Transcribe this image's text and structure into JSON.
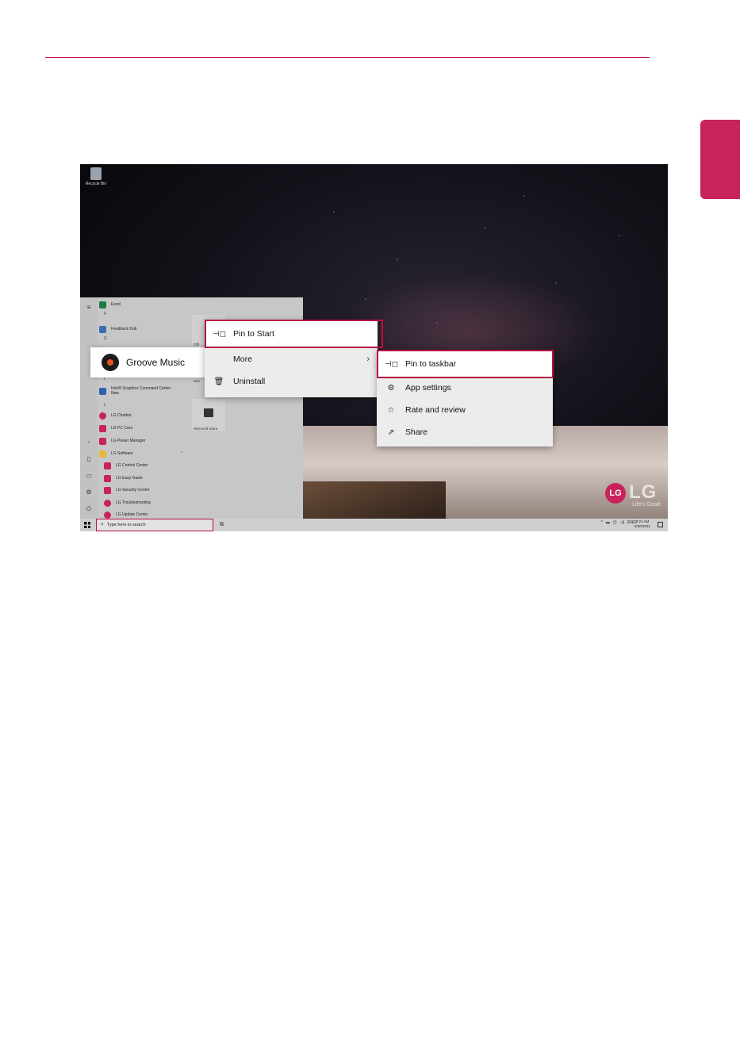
{
  "desktop": {
    "recycle_bin_label": "Recycle Bin",
    "brand": {
      "mark": "LG",
      "name": "LG",
      "tagline": "Life's Good",
      "color": "#c8235b"
    }
  },
  "start_menu": {
    "apps": [
      {
        "label": "Excel",
        "color": "#1d7a45"
      },
      {
        "label": "Feedback Hub",
        "color": "#3a6fb0"
      },
      {
        "label": "Intel® Graphics Command Center",
        "sub": "New",
        "color": "#2a62b0"
      },
      {
        "label": "LG Chatbot",
        "color": "#c8235b"
      },
      {
        "label": "LG PC Care",
        "color": "#c8235b"
      },
      {
        "label": "LG Power Manager",
        "color": "#c8235b"
      },
      {
        "label": "LG Software",
        "color": "#e6b840"
      },
      {
        "label": "LG Control Center",
        "color": "#c8235b"
      },
      {
        "label": "LG Easy Guide",
        "color": "#c8235b"
      },
      {
        "label": "LG Security Center",
        "color": "#c8235b"
      },
      {
        "label": "LG Troubleshooting",
        "color": "#c8235b"
      },
      {
        "label": "LG Update Center",
        "color": "#c8235b"
      }
    ],
    "letters": [
      "F",
      "G",
      "I",
      "L"
    ],
    "tiles": [
      {
        "label": "Offi"
      },
      {
        "label": "Micr"
      },
      {
        "label": "Microsoft Store"
      }
    ],
    "highlighted_app": {
      "label": "Groove Music"
    }
  },
  "context_menu": {
    "items": [
      {
        "label": "Pin to Start",
        "icon": "pin-icon"
      },
      {
        "label": "More",
        "icon": ""
      },
      {
        "label": "Uninstall",
        "icon": "trash-icon"
      }
    ]
  },
  "submenu": {
    "items": [
      {
        "label": "Pin to taskbar",
        "icon": "pin-icon"
      },
      {
        "label": "App settings",
        "icon": "gear-icon"
      },
      {
        "label": "Rate and review",
        "icon": "star-icon"
      },
      {
        "label": "Share",
        "icon": "share-icon"
      }
    ]
  },
  "taskbar": {
    "search_placeholder": "Type here to search",
    "tray_lang": "ENG",
    "clock_time": "8:21 AM",
    "clock_date": "5/30/2021"
  },
  "colors": {
    "highlight_outline": "#b8123f",
    "accent": "#c8235b"
  }
}
